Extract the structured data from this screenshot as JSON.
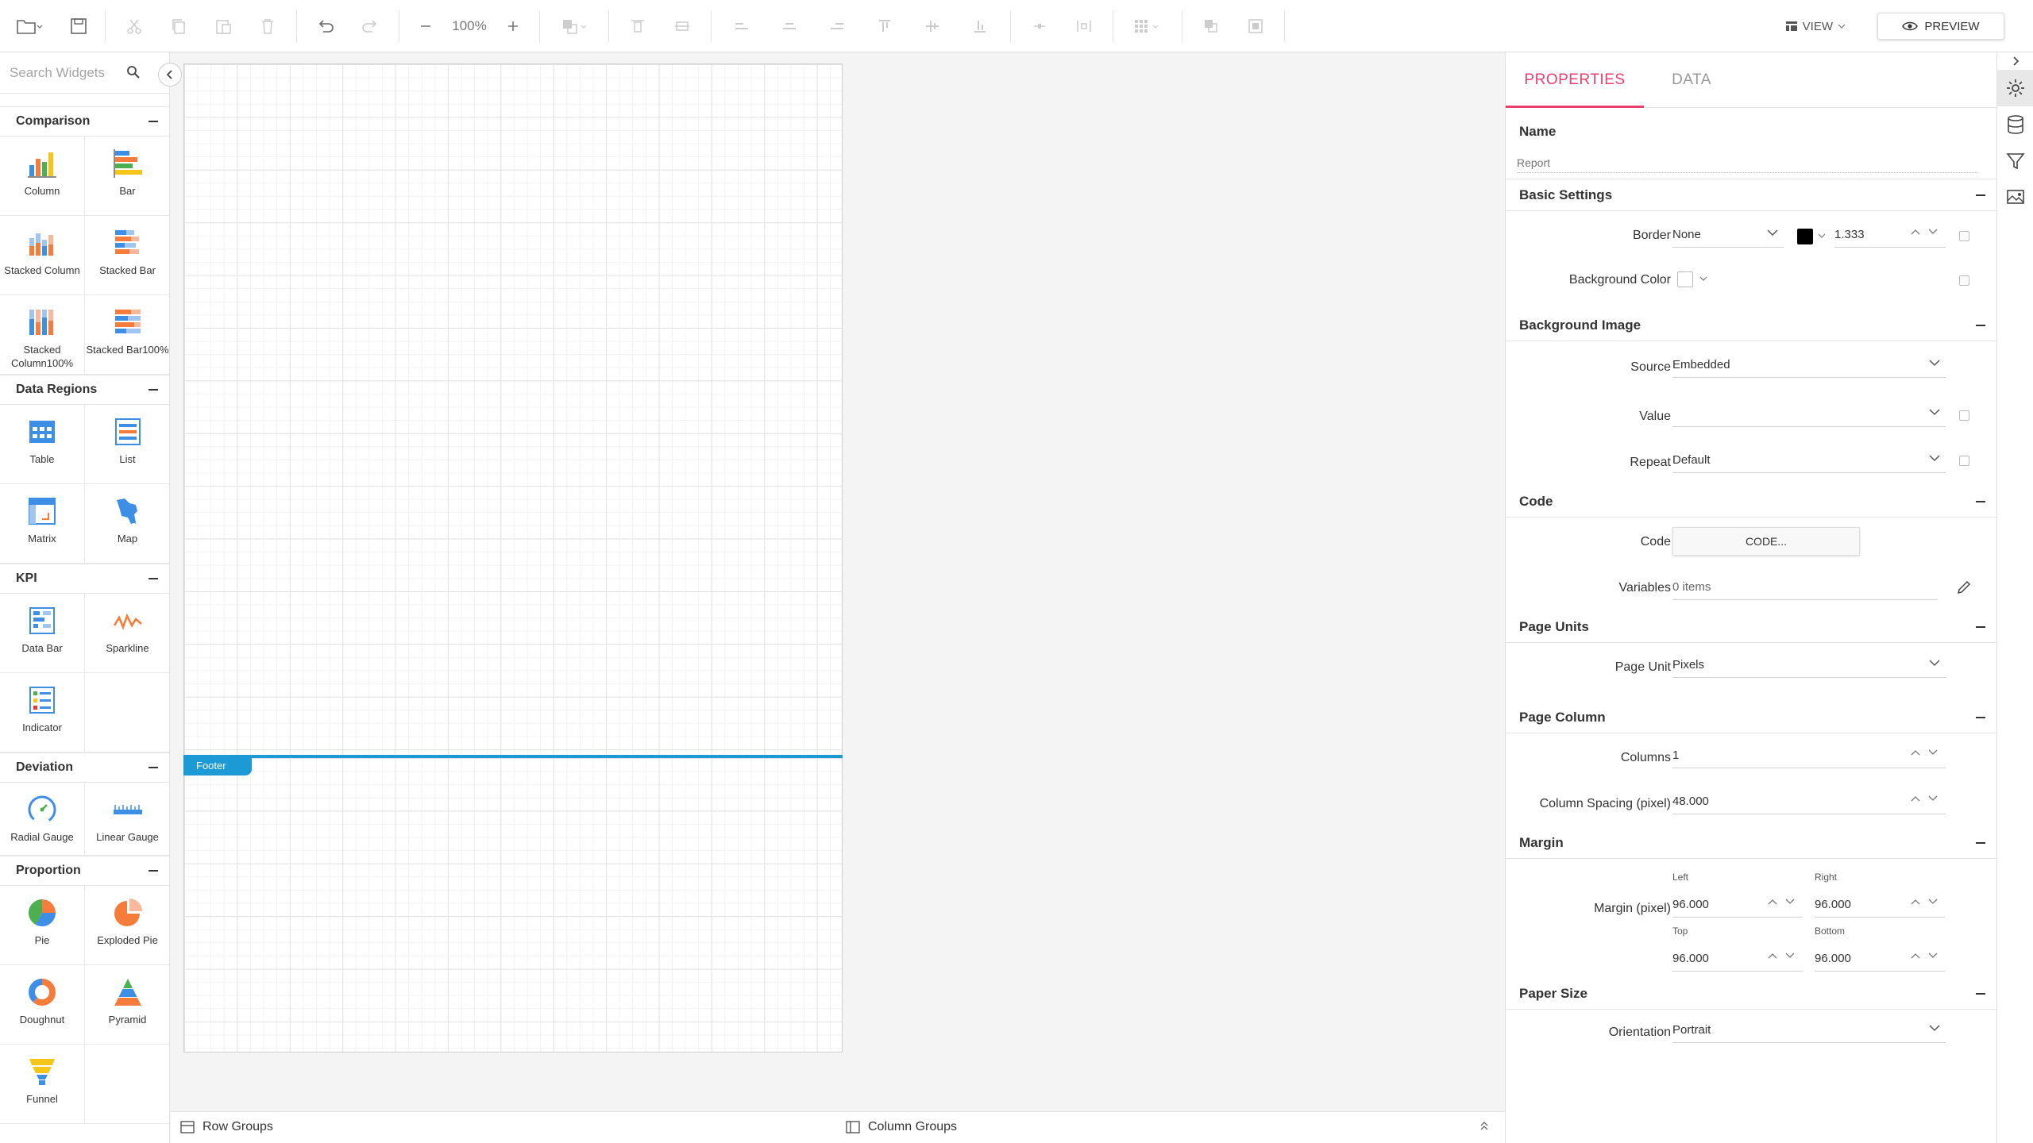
{
  "toolbar": {
    "zoom": "100%",
    "view_label": "VIEW",
    "preview_label": "PREVIEW"
  },
  "widgets": {
    "search_placeholder": "Search Widgets",
    "categories": [
      {
        "name": "Comparison",
        "items": [
          "Column",
          "Bar",
          "Stacked Column",
          "Stacked Bar",
          "Stacked Column100%",
          "Stacked Bar100%"
        ]
      },
      {
        "name": "Data Regions",
        "items": [
          "Table",
          "List",
          "Matrix",
          "Map"
        ]
      },
      {
        "name": "KPI",
        "items": [
          "Data Bar",
          "Sparkline",
          "Indicator"
        ]
      },
      {
        "name": "Deviation",
        "items": [
          "Radial Gauge",
          "Linear Gauge"
        ]
      },
      {
        "name": "Proportion",
        "items": [
          "Pie",
          "Exploded Pie",
          "Doughnut",
          "Pyramid",
          "Funnel"
        ]
      }
    ]
  },
  "canvas": {
    "footer_label": "Footer"
  },
  "bottom_bar": {
    "row_groups": "Row Groups",
    "column_groups": "Column Groups"
  },
  "properties": {
    "tabs": [
      "PROPERTIES",
      "DATA"
    ],
    "name_label": "Name",
    "name_placeholder": "Report",
    "sections": {
      "basic_settings": "Basic Settings",
      "background_image": "Background Image",
      "code": "Code",
      "page_units": "Page Units",
      "page_column": "Page Column",
      "margin": "Margin",
      "paper_size": "Paper Size"
    },
    "border_label": "Border",
    "border_value": "None",
    "border_width": "1.333",
    "background_color_label": "Background Color",
    "source_label": "Source",
    "source_value": "Embedded",
    "value_label": "Value",
    "value_value": "",
    "repeat_label": "Repeat",
    "repeat_value": "Default",
    "code_label": "Code",
    "code_button": "CODE...",
    "variables_label": "Variables",
    "variables_value": "0 items",
    "page_unit_label": "Page Unit",
    "page_unit_value": "Pixels",
    "columns_label": "Columns",
    "columns_value": "1",
    "column_spacing_label": "Column Spacing (pixel)",
    "column_spacing_value": "48.000",
    "margin_label": "Margin (pixel)",
    "margin_left_label": "Left",
    "margin_right_label": "Right",
    "margin_top_label": "Top",
    "margin_bottom_label": "Bottom",
    "margin_left": "96.000",
    "margin_right": "96.000",
    "margin_top": "96.000",
    "margin_bottom": "96.000",
    "orientation_label": "Orientation",
    "orientation_value": "Portrait"
  },
  "colors": {
    "accent_pink": "#e83f6f",
    "footer_blue": "#1c9ad6",
    "border_color_swatch": "#000000"
  }
}
